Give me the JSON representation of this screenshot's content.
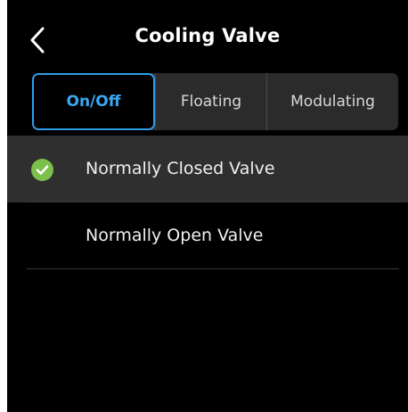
{
  "header": {
    "title": "Cooling Valve",
    "back_icon": "chevron-left-icon"
  },
  "tabs": [
    {
      "label": "On/Off",
      "active": true
    },
    {
      "label": "Floating",
      "active": false
    },
    {
      "label": "Modulating",
      "active": false
    }
  ],
  "options": [
    {
      "label": "Normally Closed Valve",
      "selected": true,
      "icon": "check-circle-icon"
    },
    {
      "label": "Normally Open Valve",
      "selected": false
    }
  ],
  "colors": {
    "background": "#000000",
    "accent": "#3aa7f2",
    "check_green": "#7cc04b",
    "segment_bg": "#2b2b2b",
    "selected_row_bg": "#2f2f2f"
  }
}
